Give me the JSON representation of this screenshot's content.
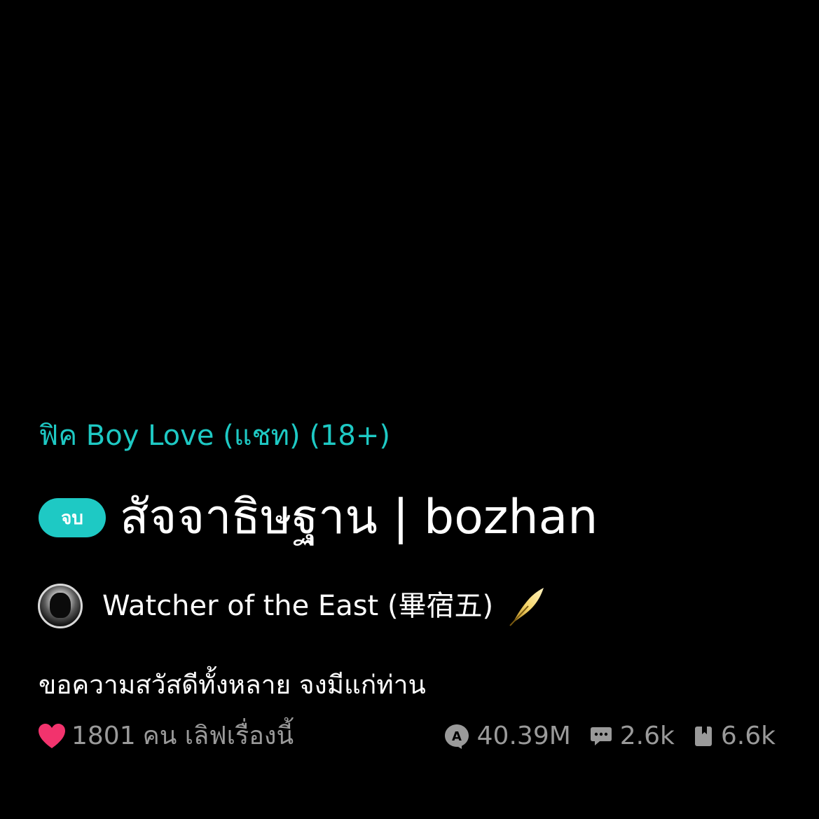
{
  "category": "ฟิค Boy Love (แชท) (18+)",
  "story": {
    "status_badge": "จบ",
    "title": "สัจจาธิษฐาน | bozhan"
  },
  "author": {
    "name": "Watcher of the East (畢宿五)",
    "badge_icon": "feather-icon"
  },
  "description": "ขอความสวัสดีทั้งหลาย จงมีแก่ท่าน",
  "likes": {
    "count": "1801",
    "suffix": "คน เลิฟเรื่องนี้",
    "icon": "heart-icon"
  },
  "stats": {
    "views": "40.39M",
    "comments": "2.6k",
    "bookmarks": "6.6k"
  },
  "colors": {
    "background": "#000000",
    "accent": "#1ec9c4",
    "heart": "#f2336d",
    "muted_text": "#9a9a9a",
    "feather": "#e0b83a"
  }
}
